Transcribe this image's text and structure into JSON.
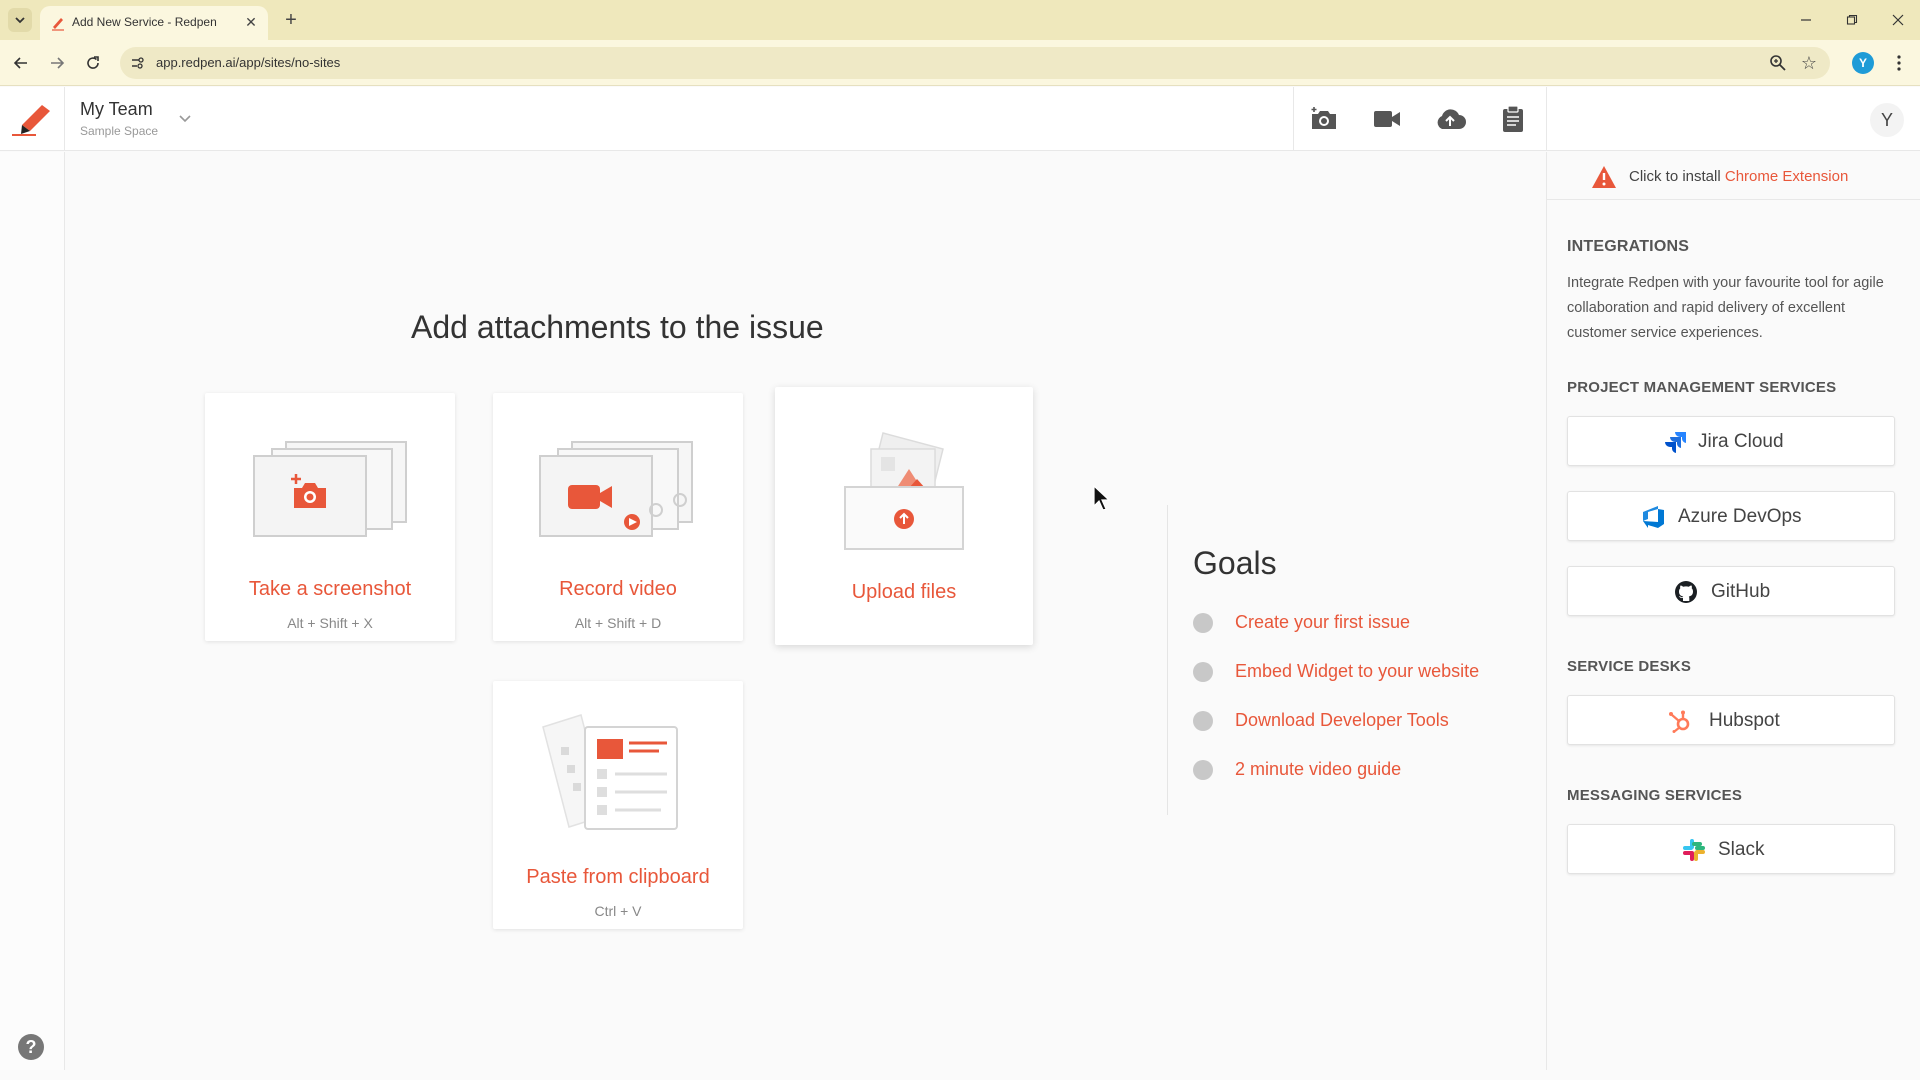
{
  "browser": {
    "tab_title": "Add New Service - Redpen",
    "url": "app.redpen.ai/app/sites/no-sites",
    "profile_initial": "Y"
  },
  "header": {
    "team_name": "My Team",
    "team_sub": "Sample Space",
    "user_initial": "Y"
  },
  "main": {
    "title": "Add attachments to the issue",
    "cards": [
      {
        "label": "Take a screenshot",
        "shortcut": "Alt + Shift + X"
      },
      {
        "label": "Record video",
        "shortcut": "Alt + Shift + D"
      },
      {
        "label": "Upload files",
        "shortcut": ""
      },
      {
        "label": "Paste from clipboard",
        "shortcut": "Ctrl + V"
      }
    ]
  },
  "goals": {
    "title": "Goals",
    "items": [
      "Create your first issue",
      "Embed Widget to your website",
      "Download Developer Tools",
      "2 minute video guide"
    ]
  },
  "right_panel": {
    "banner_text": "Click to install",
    "banner_link1": "Chrome",
    "banner_link2": "Extension",
    "integrations_title": "INTEGRATIONS",
    "integrations_intro": "Integrate Redpen with your favourite tool for agile collaboration and rapid delivery of excellent customer service experiences.",
    "pm_title": "PROJECT MANAGEMENT SERVICES",
    "pm_services": [
      "Jira Cloud",
      "Azure DevOps",
      "GitHub"
    ],
    "sd_title": "SERVICE DESKS",
    "sd_services": [
      "Hubspot"
    ],
    "ms_title": "MESSAGING SERVICES",
    "ms_services": [
      "Slack"
    ]
  },
  "colors": {
    "accent": "#e8573a",
    "chrome_bar": "#efe8bc"
  },
  "icons": [
    "tab-list-icon",
    "redpen-favicon",
    "close-icon",
    "plus-icon",
    "minimize-icon",
    "restore-icon",
    "window-close-icon",
    "back-icon",
    "forward-icon",
    "reload-icon",
    "site-info-icon",
    "zoom-icon",
    "star-icon",
    "kebab-menu-icon",
    "redpen-logo",
    "chevron-down-icon",
    "camera-icon",
    "video-icon",
    "cloud-upload-icon",
    "clipboard-icon",
    "warning-icon",
    "jira-icon",
    "azure-devops-icon",
    "github-icon",
    "hubspot-icon",
    "slack-icon",
    "help-icon"
  ]
}
